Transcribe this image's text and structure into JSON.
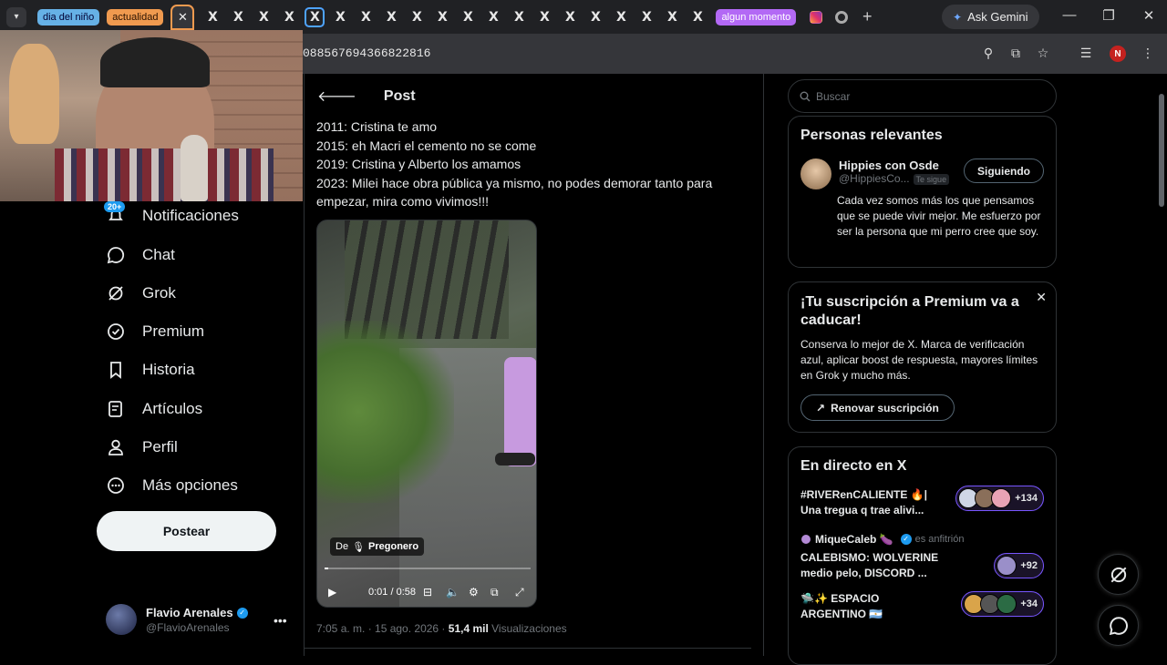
{
  "browser": {
    "tab_groups": [
      "dia del niño",
      "actualidad",
      "algun momento"
    ],
    "x_tab_glyph": "X",
    "url": "088567694366822816",
    "ask_gemini": "Ask Gemini",
    "profile_initial": "N",
    "icons": [
      "tab-search-icon",
      "close-icon",
      "instagram-icon",
      "chrome-icon",
      "new-tab-icon",
      "zoom-icon",
      "install-icon",
      "bookmark-star-icon",
      "reading-list-icon",
      "menu-dots-icon"
    ]
  },
  "nav": {
    "notifications_badge": "20+",
    "items": [
      {
        "label": "Notificaciones",
        "icon": "bell-icon"
      },
      {
        "label": "Chat",
        "icon": "chat-icon"
      },
      {
        "label": "Grok",
        "icon": "grok-icon"
      },
      {
        "label": "Premium",
        "icon": "premium-icon"
      },
      {
        "label": "Historia",
        "icon": "bookmark-icon"
      },
      {
        "label": "Artículos",
        "icon": "articles-icon"
      },
      {
        "label": "Perfil",
        "icon": "profile-icon"
      },
      {
        "label": "Más opciones",
        "icon": "more-circle-icon"
      }
    ],
    "post_button": "Postear",
    "account": {
      "name": "Flavio Arenales",
      "handle": "@FlavioArenales"
    }
  },
  "post": {
    "header": "Post",
    "lines": [
      "2011: Cristina te amo",
      "2015: eh Macri el cemento no se come",
      "2019: Cristina y Alberto los amamos",
      "2023: Milei hace obra pública ya mismo, no podes demorar tanto para empezar, mira como vivimos!!!"
    ],
    "video": {
      "source_prefix": "De",
      "source_name": "Pregonero",
      "time": "0:01 / 0:58",
      "progress": 0.017
    },
    "meta_time": "7:05 a. m. · 15 ago. 2026 · ",
    "meta_views_count": "51,4 mil",
    "meta_views_label": " Visualizaciones"
  },
  "sidebar": {
    "search_placeholder": "Buscar",
    "relevant": {
      "title": "Personas relevantes",
      "name": "Hippies con Osde",
      "handle": "@HippiesCo...",
      "follows_you": "Te sigue",
      "button": "Siguiendo",
      "bio": "Cada vez somos más los que pensamos que se puede vivir mejor. Me esfuerzo por ser la persona que mi perro cree que soy."
    },
    "premium": {
      "title": "¡Tu suscripción a Premium va a caducar!",
      "body": "Conserva lo mejor de X. Marca de verificación azul, aplicar boost de respuesta, mayores límites en Grok y mucho más.",
      "button": "Renovar suscripción"
    },
    "live": {
      "title": "En directo en X",
      "items": [
        {
          "title": "#RIVERenCALIENTE 🔥| Una tregua q trae alivi...",
          "count": "+134",
          "host": "",
          "host_suffix": ""
        },
        {
          "title": "CALEBISMO: WOLVERINE medio pelo, DISCORD ...",
          "count": "+92",
          "host": "MiqueCaleb 🍆",
          "host_suffix": "es anfitrión"
        },
        {
          "title": "🛸✨ ESPACIO ARGENTINO 🇦🇷",
          "count": "+34",
          "host": "",
          "host_suffix": ""
        }
      ]
    }
  },
  "colors": {
    "accent": "#1d9bf0",
    "live_border": "#7856ff",
    "tab_orange": "#f09a4f",
    "tab_blue": "#66b1e6",
    "tab_purple": "#b369f5"
  }
}
